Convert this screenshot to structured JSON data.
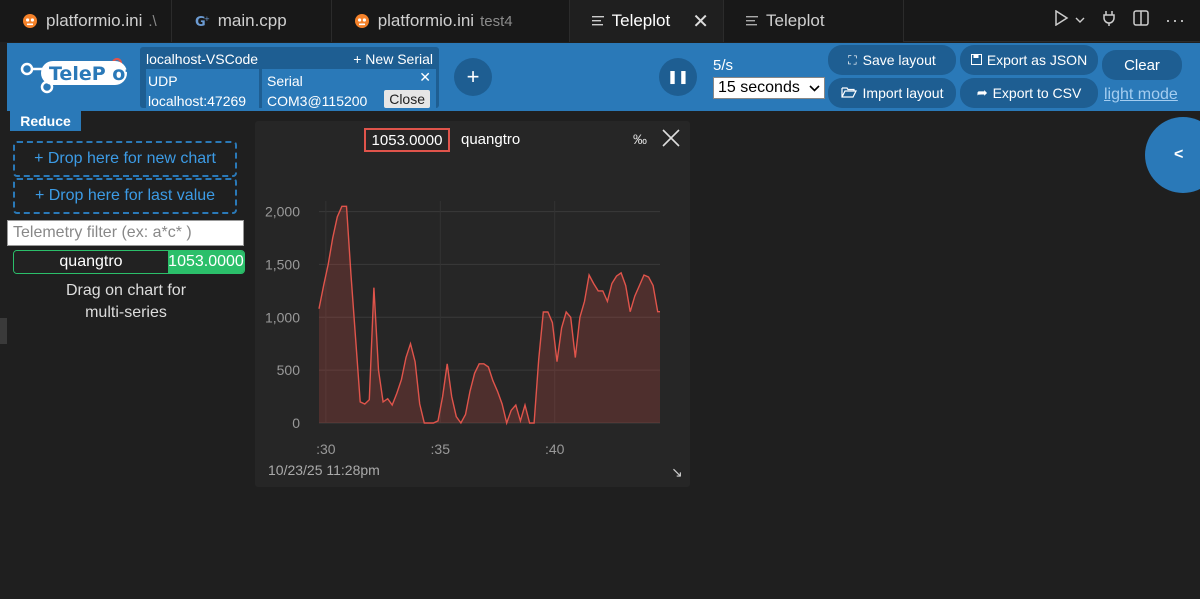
{
  "tabs": [
    {
      "label": "platformio.ini",
      "sub": ".\\",
      "icon": "platformio-icon"
    },
    {
      "label": "main.cpp",
      "sub": "",
      "icon": "cpp-icon"
    },
    {
      "label": "platformio.ini",
      "sub": "test4",
      "icon": "platformio-icon"
    },
    {
      "label": "Teleplot",
      "sub": "",
      "icon": "file-lines-icon",
      "active": true
    },
    {
      "label": "Teleplot",
      "sub": "",
      "icon": "file-lines-icon"
    }
  ],
  "logo": {
    "text": "TeleP ot"
  },
  "connection": {
    "title": "localhost-VSCode",
    "new_serial": "+ New Serial",
    "udp": {
      "label": "UDP",
      "address": "localhost:47269"
    },
    "serial": {
      "label": "Serial",
      "port": "COM3@115200",
      "close": "Close",
      "remove": "✕"
    }
  },
  "toolbar": {
    "add": "+",
    "pause": "❚❚",
    "rate": "5/s",
    "time_window": "15 seconds",
    "save_layout": "Save layout",
    "import_layout": "Import layout",
    "export_json": "Export as JSON",
    "export_csv": "Export to CSV",
    "clear": "Clear",
    "light_mode": "light mode"
  },
  "left_panel": {
    "reduce": "Reduce",
    "drop_new": "+ Drop here for new chart",
    "drop_last": "+ Drop here for last value",
    "filter_placeholder": "Telemetry filter (ex: a*c* )",
    "telemetry": {
      "name": "quangtro",
      "value": "1053.0000"
    },
    "hint_line1": "Drag on chart for",
    "hint_line2": "multi-series"
  },
  "chart": {
    "value": "1053.0000",
    "series": "quangtro",
    "permille": "‰",
    "timestamp": "10/23/25 11:28pm",
    "resize": "↘"
  },
  "expander": "<",
  "colors": {
    "accent": "#2a79b8",
    "series": "#e0544b",
    "value_green": "#2bbf6a"
  },
  "chart_data": {
    "type": "area",
    "y_ticks": [
      "0",
      "500",
      "1,000",
      "1,500",
      "2,000"
    ],
    "x_ticks": [
      ":30",
      ":35",
      ":40"
    ],
    "ylim": [
      0,
      2100
    ],
    "xlim": [
      29.7,
      44.6
    ],
    "x_tick_values": [
      30,
      35,
      40
    ],
    "y_tick_values": [
      0,
      500,
      1000,
      1500,
      2000
    ],
    "series": [
      {
        "name": "quangtro",
        "x": [
          29.7,
          29.9,
          30.1,
          30.3,
          30.5,
          30.7,
          30.9,
          31.1,
          31.3,
          31.5,
          31.7,
          31.9,
          32.1,
          32.3,
          32.5,
          32.7,
          32.9,
          33.1,
          33.3,
          33.5,
          33.7,
          33.9,
          34.1,
          34.3,
          34.5,
          34.7,
          34.9,
          35.1,
          35.3,
          35.5,
          35.7,
          35.9,
          36.1,
          36.3,
          36.5,
          36.7,
          36.9,
          37.1,
          37.3,
          37.5,
          37.7,
          37.9,
          38.1,
          38.3,
          38.5,
          38.7,
          38.9,
          39.1,
          39.3,
          39.5,
          39.7,
          39.9,
          40.1,
          40.3,
          40.5,
          40.7,
          40.9,
          41.1,
          41.3,
          41.5,
          41.7,
          41.9,
          42.1,
          42.3,
          42.5,
          42.7,
          42.9,
          43.1,
          43.3,
          43.5,
          43.7,
          43.9,
          44.1,
          44.3,
          44.5,
          44.6
        ],
        "y": [
          1080,
          1300,
          1500,
          1750,
          1950,
          2050,
          2050,
          1400,
          800,
          200,
          180,
          220,
          1280,
          500,
          200,
          230,
          170,
          280,
          410,
          620,
          750,
          580,
          180,
          0,
          0,
          0,
          20,
          250,
          560,
          250,
          60,
          0,
          80,
          300,
          470,
          560,
          560,
          530,
          400,
          300,
          180,
          0,
          120,
          170,
          20,
          170,
          0,
          0,
          600,
          1050,
          1050,
          950,
          580,
          900,
          1050,
          1000,
          620,
          1000,
          1150,
          1400,
          1320,
          1250,
          1250,
          1150,
          1320,
          1390,
          1420,
          1300,
          1053,
          1200,
          1300,
          1400,
          1380,
          1300,
          1053,
          1053
        ]
      }
    ]
  }
}
